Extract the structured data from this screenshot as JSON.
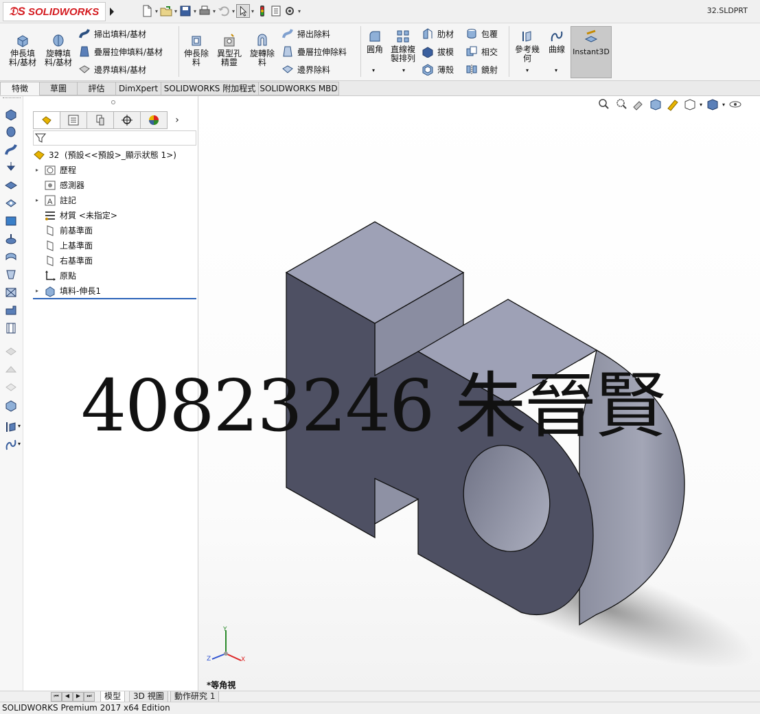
{
  "app": {
    "brand": "SOLIDWORKS",
    "document_title": "32.SLDPRT"
  },
  "command_manager": {
    "features": [
      {
        "label": "伸長填\n料/基材",
        "icon": "extrude-boss-icon"
      },
      {
        "label": "旋轉填\n料/基材",
        "icon": "revolve-boss-icon"
      }
    ],
    "feature_small": [
      {
        "label": "掃出填料/基材",
        "icon": "sweep-boss-icon"
      },
      {
        "label": "疊層拉伸填料/基材",
        "icon": "loft-boss-icon"
      },
      {
        "label": "邊界填料/基材",
        "icon": "boundary-boss-icon"
      }
    ],
    "cut_features": [
      {
        "label": "伸長除\n料",
        "icon": "extrude-cut-icon"
      },
      {
        "label": "異型孔\n精靈",
        "icon": "hole-wizard-icon"
      },
      {
        "label": "旋轉除\n料",
        "icon": "revolve-cut-icon"
      }
    ],
    "cut_small": [
      {
        "label": "掃出除料",
        "icon": "sweep-cut-icon"
      },
      {
        "label": "疊層拉伸除料",
        "icon": "loft-cut-icon"
      },
      {
        "label": "邊界除料",
        "icon": "boundary-cut-icon"
      }
    ],
    "fillet": {
      "label": "圓角",
      "icon": "fillet-icon"
    },
    "pattern": {
      "label": "直線複\n製排列",
      "icon": "linear-pattern-icon"
    },
    "mods": [
      {
        "label": "肋材",
        "icon": "rib-icon"
      },
      {
        "label": "包覆",
        "icon": "wrap-icon"
      },
      {
        "label": "拔模",
        "icon": "draft-icon"
      },
      {
        "label": "相交",
        "icon": "intersect-icon"
      },
      {
        "label": "薄殼",
        "icon": "shell-icon"
      },
      {
        "label": "鏡射",
        "icon": "mirror-icon"
      }
    ],
    "ref_geometry": {
      "label": "參考幾\n何",
      "icon": "reference-geometry-icon"
    },
    "curves": {
      "label": "曲線",
      "icon": "curves-icon"
    },
    "instant3d": {
      "label": "Instant3D",
      "icon": "instant3d-icon"
    }
  },
  "tabs": [
    {
      "label": "特徵",
      "active": true
    },
    {
      "label": "草圖",
      "active": false
    },
    {
      "label": "評估",
      "active": false
    },
    {
      "label": "DimXpert",
      "active": false
    },
    {
      "label": "SOLIDWORKS 附加程式",
      "active": false
    },
    {
      "label": "SOLIDWORKS MBD",
      "active": false
    }
  ],
  "feature_tree": {
    "root": "32  (預設<<預設>_顯示狀態 1>)",
    "items": [
      {
        "label": "歷程",
        "icon": "history-icon",
        "expandable": true
      },
      {
        "label": "感測器",
        "icon": "sensor-icon",
        "expandable": false
      },
      {
        "label": "註記",
        "icon": "annotations-icon",
        "expandable": true
      },
      {
        "label": "材質 <未指定>",
        "icon": "material-icon",
        "expandable": false
      },
      {
        "label": "前基準面",
        "icon": "plane-icon",
        "expandable": false
      },
      {
        "label": "上基準面",
        "icon": "plane-icon",
        "expandable": false
      },
      {
        "label": "右基準面",
        "icon": "plane-icon",
        "expandable": false
      },
      {
        "label": "原點",
        "icon": "origin-icon",
        "expandable": false
      },
      {
        "label": "填料-伸長1",
        "icon": "extrude-feature-icon",
        "expandable": true
      }
    ]
  },
  "viewport": {
    "view_name": "*等角視",
    "watermark": "40823246 朱晉賢",
    "axes": {
      "x": "X",
      "y": "Y",
      "z": "Z"
    },
    "model_color": "#9a9db0"
  },
  "bottom_tabs": [
    {
      "label": "模型",
      "active": true
    },
    {
      "label": "3D 視圖",
      "active": false
    },
    {
      "label": "動作研究 1",
      "active": false
    }
  ],
  "status_bar": "SOLIDWORKS Premium 2017 x64 Edition"
}
